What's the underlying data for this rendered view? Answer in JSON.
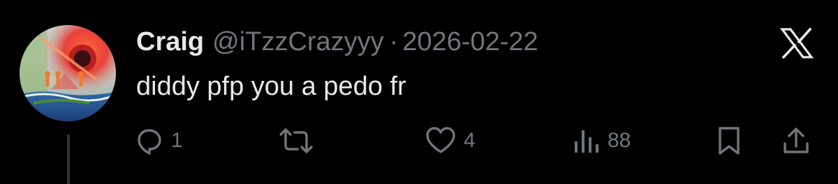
{
  "tweet": {
    "display_name": "Craig",
    "handle": "@iTzzCrazyyy",
    "separator": "·",
    "timestamp": "2026-02-22",
    "text": "diddy pfp you a pedo fr"
  },
  "actions": {
    "reply_count": "1",
    "retweet_count": "",
    "like_count": "4",
    "views_count": "88"
  },
  "icons": {
    "brand": "x-logo-icon",
    "reply": "reply-icon",
    "retweet": "retweet-icon",
    "like": "heart-icon",
    "views": "views-icon",
    "bookmark": "bookmark-icon",
    "share": "share-icon"
  },
  "colors": {
    "background": "#000000",
    "primary_text": "#e7e9ea",
    "secondary_text": "#71767b",
    "thread_line": "#333639"
  }
}
